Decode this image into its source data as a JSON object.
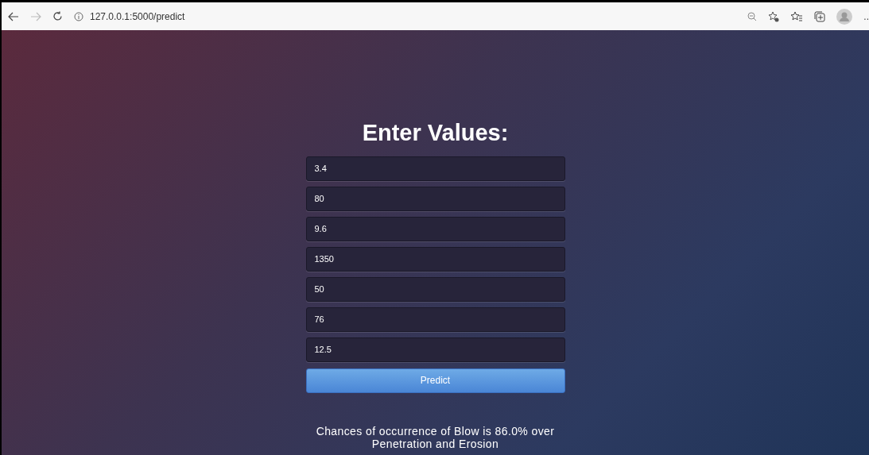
{
  "browser": {
    "url": "127.0.0.1:5000/predict",
    "more_label": ".."
  },
  "heading": "Enter Values:",
  "fields": [
    {
      "value": "3.4"
    },
    {
      "value": "80"
    },
    {
      "value": "9.6"
    },
    {
      "value": "1350"
    },
    {
      "value": "50"
    },
    {
      "value": "76"
    },
    {
      "value": "12.5"
    }
  ],
  "button": "Predict",
  "result": "Chances of occurrence of Blow is 86.0% over Penetration and Erosion"
}
